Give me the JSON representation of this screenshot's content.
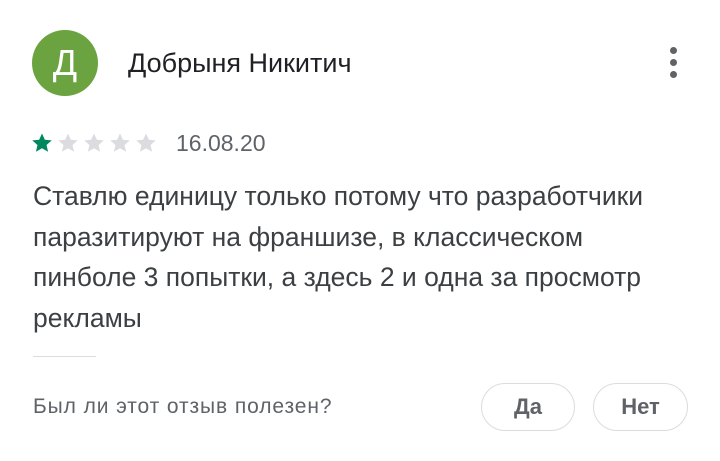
{
  "review": {
    "author_initial": "Д",
    "author_name": "Добрыня Никитич",
    "rating": 1,
    "rating_max": 5,
    "date": "16.08.20",
    "text": "Ставлю единицу только потому что разработчики паразитируют на франшизе, в классическом пинболе 3 попытки, а здесь 2 и одна за просмотр рекламы"
  },
  "helpful": {
    "question": "Был ли этот отзыв полезен?",
    "yes_label": "Да",
    "no_label": "Нет"
  },
  "colors": {
    "avatar_bg": "#6aa33f",
    "star_filled": "#01875f",
    "star_empty": "#dadce0"
  }
}
